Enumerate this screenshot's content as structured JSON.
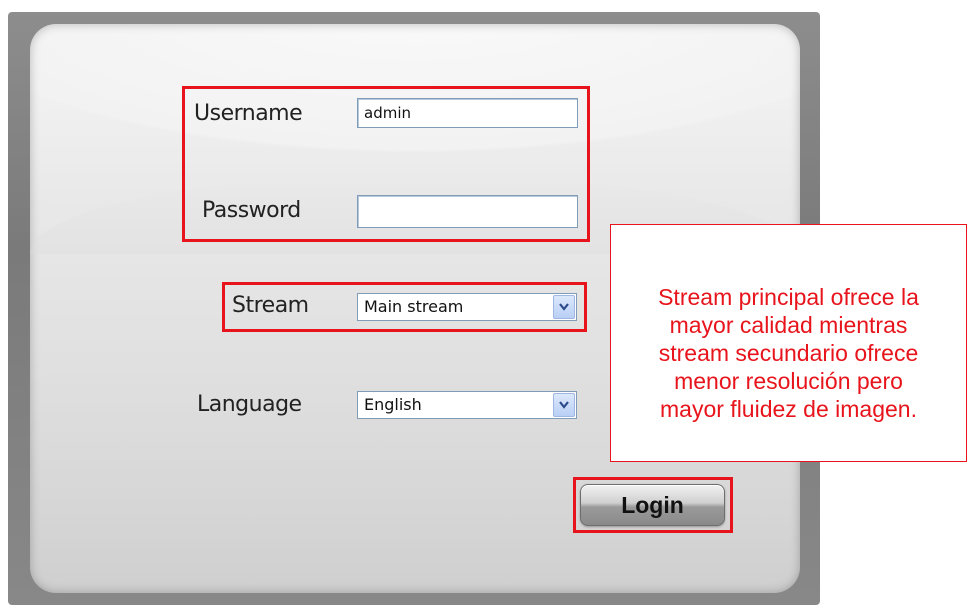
{
  "form": {
    "username_label": "Username",
    "username_value": "admin",
    "password_label": "Password",
    "password_value": "",
    "stream_label": "Stream",
    "stream_value": "Main stream",
    "language_label": "Language",
    "language_value": "English",
    "login_label": "Login"
  },
  "annotation": {
    "lines": [
      "Stream principal ofrece la",
      "mayor calidad mientras",
      "stream secundario ofrece",
      "menor resolución pero",
      "mayor fluidez de imagen."
    ]
  },
  "colors": {
    "highlight": "#e8141c",
    "input_border": "#7f9db9"
  }
}
